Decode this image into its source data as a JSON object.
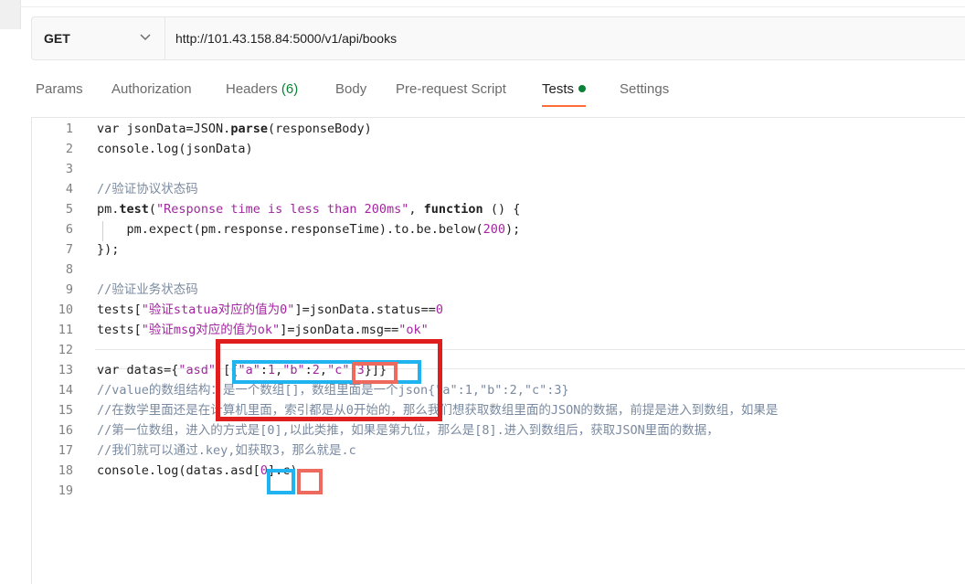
{
  "request": {
    "method": "GET",
    "url": "http://101.43.158.84:5000/v1/api/books"
  },
  "tabs": [
    {
      "label": "Params"
    },
    {
      "label": "Authorization"
    },
    {
      "label": "Headers",
      "count": "(6)"
    },
    {
      "label": "Body"
    },
    {
      "label": "Pre-request Script"
    },
    {
      "label": "Tests",
      "active": true,
      "indicator": "green-dot"
    },
    {
      "label": "Settings"
    }
  ],
  "editor": {
    "line_numbers": [
      "1",
      "2",
      "3",
      "4",
      "5",
      "6",
      "7",
      "8",
      "9",
      "10",
      "11",
      "12",
      "13",
      "14",
      "15",
      "16",
      "17",
      "18",
      "19"
    ],
    "lines": [
      "var jsonData=JSON.parse(responseBody)",
      "console.log(jsonData)",
      "",
      "//验证协议状态码",
      "pm.test(\"Response time is less than 200ms\", function () {",
      "    pm.expect(pm.response.responseTime).to.be.below(200);",
      "});",
      "",
      "//验证业务状态码",
      "tests[\"验证statua对应的值为0\"]=jsonData.status==0",
      "tests[\"验证msg对应的值为ok\"]=jsonData.msg==\"ok\"",
      "",
      "var datas={\"asd\":[{\"a\":1,\"b\":2,\"c\":3}]}",
      "//value的数组结构：是一个数组[]，数组里面是一个json{\"a\":1,\"b\":2,\"c\":3}",
      "//在数学里面还是在计算机里面，索引都是从0开始的，那么我们想获取数组里面的JSON的数据，前提是进入到数组，如果是",
      "//第一位数组，进入的方式是[0],以此类推，如果是第九位，那么是[8].进入到数组后，获取JSON里面的数据，",
      "//我们就可以通过.key,如获取3，那么就是.c",
      "console.log(datas.asd[0].c)",
      ""
    ]
  },
  "annotation_colors": {
    "red": "#e01e1e",
    "blue": "#1fb3ef",
    "salmon": "#ef6a5e"
  },
  "colors": {
    "accent": "#ff6c37",
    "status_green": "#0b8235",
    "string": "#a1269f",
    "comment": "#7a8aa0"
  }
}
